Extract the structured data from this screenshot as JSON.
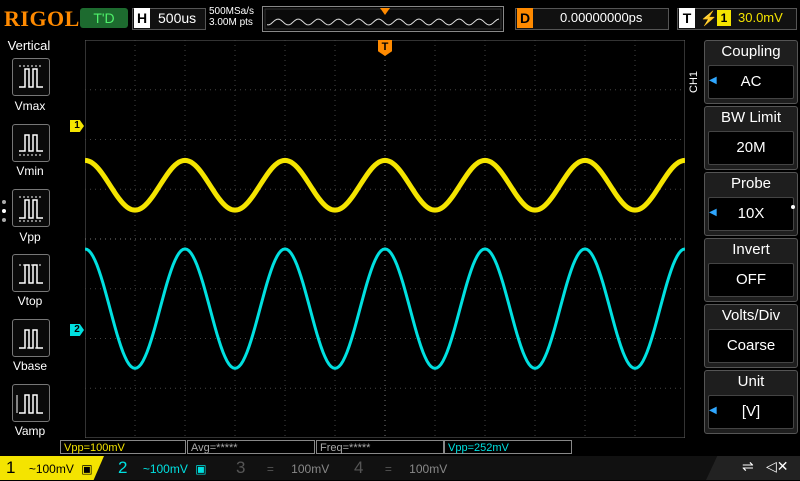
{
  "topbar": {
    "logo": "RIGOL",
    "trigger_status": "T'D",
    "horizontal_label": "H",
    "timebase": "500us",
    "sample_rate": "500MSa/s",
    "memory_depth": "3.00M pts",
    "delay_label": "D",
    "delay_value": "0.00000000ps",
    "trigger_label": "T",
    "trigger_icon": "rising-edge-icon",
    "trigger_source": "1",
    "trigger_level": "30.0mV"
  },
  "left_panel": {
    "title": "Vertical",
    "items": [
      {
        "label": "Vmax"
      },
      {
        "label": "Vmin"
      },
      {
        "label": "Vpp"
      },
      {
        "label": "Vtop"
      },
      {
        "label": "Vbase"
      },
      {
        "label": "Vamp"
      }
    ]
  },
  "markers": {
    "ch1": "1",
    "ch2": "2",
    "trigger": "T"
  },
  "right_menu": {
    "channel_tab": "CH1",
    "items": [
      {
        "title": "Coupling",
        "value": "AC",
        "has_arrow": true
      },
      {
        "title": "BW Limit",
        "value": "20M",
        "has_arrow": false
      },
      {
        "title": "Probe",
        "value": "10X",
        "has_arrow": true
      },
      {
        "title": "Invert",
        "value": "OFF",
        "has_arrow": false
      },
      {
        "title": "Volts/Div",
        "value": "Coarse",
        "has_arrow": false
      },
      {
        "title": "Unit",
        "value": "[V]",
        "has_arrow": true
      }
    ]
  },
  "measurements": [
    {
      "text": "Vpp=100mV",
      "color": "#f4e400"
    },
    {
      "text": "Avg=*****",
      "color": "#aaaaaa"
    },
    {
      "text": "Freq=*****",
      "color": "#aaaaaa"
    },
    {
      "text": "Vpp=252mV",
      "color": "#00e0e0"
    }
  ],
  "channels": [
    {
      "num": "1",
      "coupling": "~",
      "scale": "100mV",
      "color": "#f4e400",
      "active": true
    },
    {
      "num": "2",
      "coupling": "~",
      "scale": "100mV",
      "color": "#00e0e0",
      "active": false
    },
    {
      "num": "3",
      "coupling": "=",
      "scale": "100mV",
      "color": "#555555",
      "active": false
    },
    {
      "num": "4",
      "coupling": "=",
      "scale": "100mV",
      "color": "#555555",
      "active": false
    }
  ],
  "waveforms": {
    "ch1": {
      "color": "#f4e400",
      "amplitude_div": 0.5,
      "center_div": 1.08,
      "cycles": 6
    },
    "ch2": {
      "color": "#00e0e0",
      "amplitude_div": 1.2,
      "center_div": -1.4,
      "cycles": 6
    }
  },
  "status": {
    "usb_icon": "usb-icon",
    "mute_icon": "speaker-mute-icon"
  }
}
